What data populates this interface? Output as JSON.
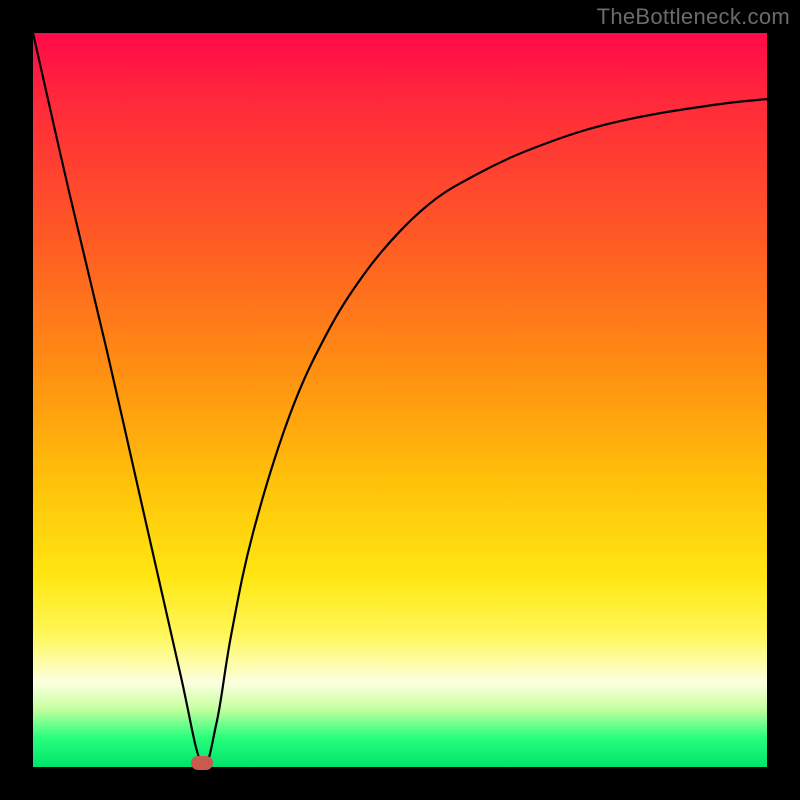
{
  "watermark": "TheBottleneck.com",
  "chart_data": {
    "type": "line",
    "title": "",
    "xlabel": "",
    "ylabel": "",
    "xlim": [
      0,
      100
    ],
    "ylim": [
      0,
      100
    ],
    "grid": false,
    "legend": false,
    "series": [
      {
        "name": "bottleneck-curve",
        "x": [
          0,
          5,
          10,
          15,
          20,
          23,
          25,
          27,
          30,
          35,
          40,
          45,
          50,
          55,
          60,
          65,
          70,
          75,
          80,
          85,
          90,
          95,
          100
        ],
        "values": [
          100,
          78,
          57,
          35,
          13,
          0.5,
          6,
          18,
          32,
          48,
          59,
          67,
          73,
          77.5,
          80.5,
          83,
          85,
          86.7,
          88,
          89,
          89.8,
          90.5,
          91
        ]
      }
    ],
    "marker": {
      "x": 23,
      "y": 0.5,
      "color": "#c95a4e"
    },
    "background_gradient": {
      "stops": [
        {
          "pct": 0,
          "color": "#ff0a49"
        },
        {
          "pct": 28,
          "color": "#ff5a25"
        },
        {
          "pct": 62,
          "color": "#ffc40a"
        },
        {
          "pct": 82,
          "color": "#fff75a"
        },
        {
          "pct": 92,
          "color": "#c7ffa0"
        },
        {
          "pct": 100,
          "color": "#00e36a"
        }
      ]
    }
  }
}
